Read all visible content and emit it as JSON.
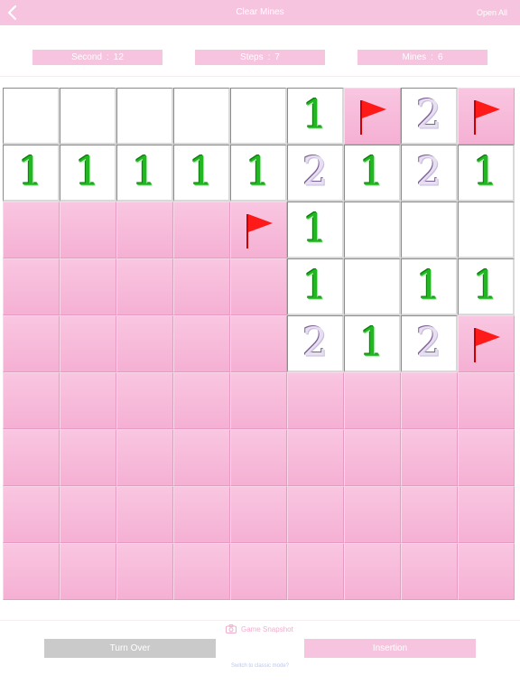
{
  "navbar": {
    "title": "Clear Mines",
    "open_all": "Open All",
    "back_icon": "chevron-left-icon"
  },
  "stats": {
    "seconds_label": "Second",
    "seconds_value": "12",
    "steps_label": "Steps",
    "steps_value": "7",
    "mines_label": "Mines",
    "mines_value": "6",
    "separator": ":"
  },
  "board": {
    "rows": 9,
    "cols": 9,
    "legend": "C = covered, F = flag, O = open empty, digit = open number",
    "cells": [
      [
        "O",
        "O",
        "O",
        "O",
        "O",
        "1",
        "F",
        "2",
        "F"
      ],
      [
        "1",
        "1",
        "1",
        "1",
        "1",
        "2",
        "1",
        "2",
        "1"
      ],
      [
        "C",
        "C",
        "C",
        "C",
        "F",
        "1",
        "O",
        "O",
        "O"
      ],
      [
        "C",
        "C",
        "C",
        "C",
        "C",
        "1",
        "O",
        "1",
        "1"
      ],
      [
        "C",
        "C",
        "C",
        "C",
        "C",
        "2",
        "1",
        "2",
        "F"
      ],
      [
        "C",
        "C",
        "C",
        "C",
        "C",
        "C",
        "C",
        "C",
        "C"
      ],
      [
        "C",
        "C",
        "C",
        "C",
        "C",
        "C",
        "C",
        "C",
        "C"
      ],
      [
        "C",
        "C",
        "C",
        "C",
        "C",
        "C",
        "C",
        "C",
        "C"
      ],
      [
        "C",
        "C",
        "C",
        "C",
        "C",
        "C",
        "C",
        "C",
        "C"
      ]
    ]
  },
  "bottom": {
    "snapshot_label": "Game Snapshot",
    "turn_over_label": "Turn Over",
    "insertion_label": "Insertion",
    "switch_mode_label": "Switch to classic mode?"
  },
  "colors": {
    "accent_pink": "#f7c4df",
    "number_one": "#22b622",
    "flag_red": "#ff1a1a",
    "disabled_gray": "#cacaca"
  }
}
